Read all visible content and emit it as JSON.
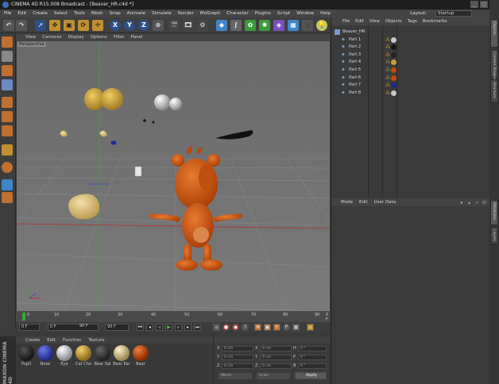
{
  "window": {
    "title": "CINEMA 4D R15.008 Broadcast - [Beaver_HR.c4d *]",
    "buttons": [
      "_",
      "□",
      "×"
    ]
  },
  "menubar": {
    "items": [
      "File",
      "Edit",
      "Create",
      "Select",
      "Tools",
      "Mesh",
      "Snap",
      "Animate",
      "Simulate",
      "Render",
      "MoGraph",
      "Character",
      "Plugins",
      "Script",
      "Window",
      "Help"
    ],
    "layout_label": "Layout:",
    "layout_value": "Startup"
  },
  "viewport": {
    "menu": [
      "View",
      "Cameras",
      "Display",
      "Options",
      "Filter",
      "Panel"
    ],
    "label": "Perspective"
  },
  "timeline": {
    "ticks": [
      "0",
      "10",
      "20",
      "30",
      "40",
      "50",
      "60",
      "70",
      "80",
      "90"
    ],
    "current_frame": "0 F"
  },
  "transport": {
    "start": "0 F",
    "current": "0 F",
    "preview_end": "90 F",
    "end": "90 F"
  },
  "materials": {
    "menu": [
      "Create",
      "Edit",
      "Function",
      "Texture"
    ],
    "items": [
      {
        "label": "Pupil",
        "color": "#151515"
      },
      {
        "label": "Nose",
        "color": "#1e2a8a"
      },
      {
        "label": "Eye",
        "color": "#d8d8d8"
      },
      {
        "label": "Cat Che",
        "color": "#c8a03c"
      },
      {
        "label": "Bear Sal",
        "color": "#202020"
      },
      {
        "label": "Bear Ear",
        "color": "#d8c89a"
      },
      {
        "label": "Bear",
        "color": "#c84a0a"
      }
    ],
    "brand": "MAXON CINEMA 4D"
  },
  "coordinates": {
    "rows": [
      {
        "axis": "X",
        "pos": "0 cm",
        "size": "0 cm",
        "rot_label": "H",
        "rot": "0 °"
      },
      {
        "axis": "Y",
        "pos": "0 cm",
        "size": "0 cm",
        "rot_label": "P",
        "rot": "0 °"
      },
      {
        "axis": "Z",
        "pos": "0 cm",
        "size": "0 cm",
        "rot_label": "B",
        "rot": "0 °"
      }
    ],
    "mode1": "World",
    "mode2": "Scale",
    "apply": "Apply"
  },
  "objects": {
    "menu": [
      "File",
      "Edit",
      "View",
      "Objects",
      "Tags",
      "Bookmarks"
    ],
    "root": "Beaver_HR",
    "items": [
      "Part 1",
      "Part 2",
      "Part 3",
      "Part 4",
      "Part 5",
      "Part 6",
      "Part 7",
      "Part 8"
    ],
    "tag_colors": [
      "#c8c8c8",
      "#151515",
      "#222222",
      "#c8a03c",
      "#c84a0a",
      "#c84a0a",
      "#1e2a8a",
      "#c8c8c8"
    ]
  },
  "attributes": {
    "menu": [
      "Mode",
      "Edit",
      "User Data"
    ]
  },
  "sidetabs": {
    "top": [
      "Objects",
      "Content Browser",
      "Structure"
    ],
    "bottom": [
      "Attributes",
      "Layers"
    ]
  },
  "colors": {
    "accent": "#4a7fc8",
    "bear": "#c84a0a",
    "viewport_bg": "#6c6c6c"
  }
}
